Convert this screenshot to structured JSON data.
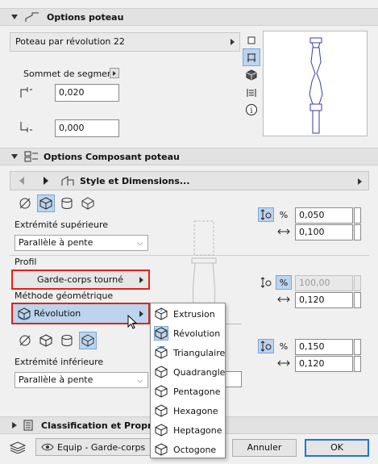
{
  "sections": {
    "options_poteau": "Options poteau",
    "options_composant": "Options Composant poteau",
    "classification": "Classification et Propriét"
  },
  "poteau": {
    "selector_value": "Poteau par révolution 22",
    "sommet_label": "Sommet de segment",
    "value_top": "0,020",
    "value_bottom": "0,000"
  },
  "style_nav": {
    "label": "Style et Dimensions..."
  },
  "extremite_sup": {
    "label": "Extrémité supérieure",
    "value": "Parallèle à pente"
  },
  "profil": {
    "label": "Profil",
    "value": "Garde-corps tourné"
  },
  "methode": {
    "label": "Méthode géométrique",
    "value": "Révolution"
  },
  "extremite_inf": {
    "label": "Extrémité inférieure",
    "value": "Parallèle à pente"
  },
  "dims": {
    "top_height": "0,050",
    "top_width": "0,100",
    "mid_height": "100,00",
    "mid_width": "0,120",
    "bot_height": "0,150",
    "bot_width": "0,120",
    "pct": "%"
  },
  "menu": {
    "items": [
      "Extrusion",
      "Révolution",
      "Triangulaire",
      "Quadrangle",
      "Pentagone",
      "Hexagone",
      "Heptagone",
      "Octogone"
    ]
  },
  "footer": {
    "layer": "Equip - Garde-corps",
    "cancel": "Annuler",
    "ok": "OK"
  },
  "colors": {
    "accent": "#1e74d6",
    "highlight": "#bcd4ee",
    "red_outline": "#e0231b"
  }
}
